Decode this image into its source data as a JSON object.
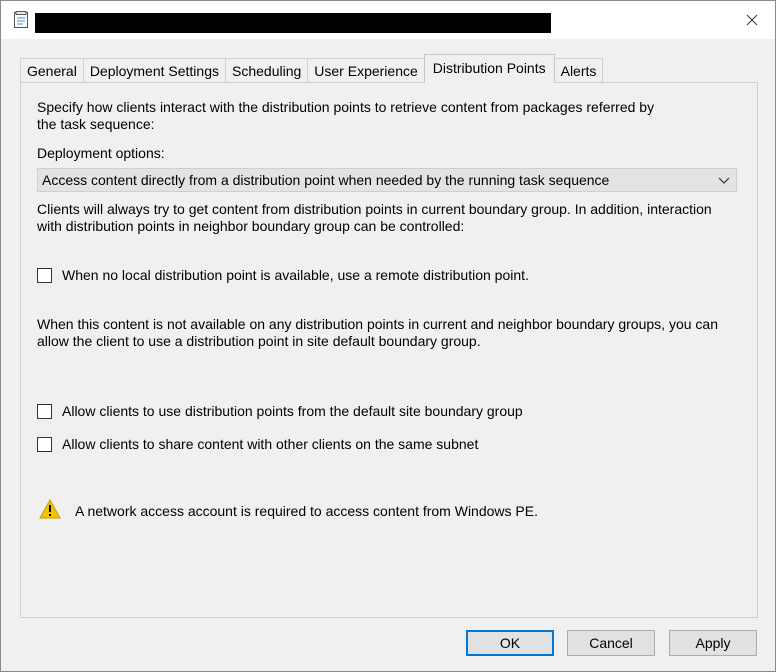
{
  "window": {
    "title": "",
    "close_icon": "close-icon",
    "app_icon": "properties-document-icon"
  },
  "tabs": [
    {
      "label": "General",
      "active": false
    },
    {
      "label": "Deployment Settings",
      "active": false
    },
    {
      "label": "Scheduling",
      "active": false
    },
    {
      "label": "User Experience",
      "active": false
    },
    {
      "label": "Distribution Points",
      "active": true
    },
    {
      "label": "Alerts",
      "active": false
    }
  ],
  "panel": {
    "intro": "Specify how clients interact with the distribution points to retrieve content from packages referred by the task sequence:",
    "deployment_options_label": "Deployment options:",
    "deployment_option_selected": "Access content directly from a distribution point when needed by the running task sequence",
    "boundary_text": "Clients will always try to get content from distribution points in current boundary group. In addition, interaction with distribution points in neighbor boundary group can be controlled:",
    "checkbox_remote": {
      "label": "When no local distribution point is available, use a remote distribution point.",
      "checked": false
    },
    "default_group_text": "When this content is not available on any distribution points in current and neighbor boundary groups, you can allow the client to use a distribution point in site default boundary group.",
    "checkbox_default_group": {
      "label": "Allow clients to use distribution points from the default site boundary group",
      "checked": false
    },
    "checkbox_share": {
      "label": "Allow clients to share content with other clients on the same subnet",
      "checked": false
    },
    "warning": {
      "icon": "warning-icon",
      "text": "A network access account is required to access content from Windows PE."
    }
  },
  "buttons": {
    "ok": "OK",
    "cancel": "Cancel",
    "apply": "Apply"
  },
  "colors": {
    "accent": "#0078d7",
    "warning": "#f5c400"
  }
}
